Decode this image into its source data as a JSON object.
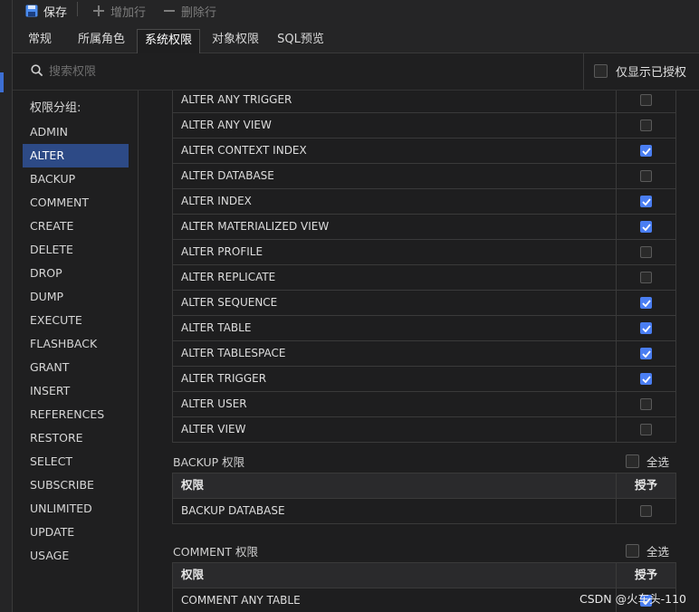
{
  "toolbar": {
    "save_label": "保存",
    "add_row_label": "增加行",
    "delete_row_label": "删除行"
  },
  "tabs": [
    {
      "label": "常规"
    },
    {
      "label": "所属角色"
    },
    {
      "label": "系统权限",
      "active": true
    },
    {
      "label": "对象权限"
    },
    {
      "label": "SQL预览"
    }
  ],
  "search": {
    "placeholder": "搜索权限",
    "value": ""
  },
  "show_granted": {
    "label": "仅显示已授权",
    "checked": false
  },
  "sidebar": {
    "group_label": "权限分组:",
    "items": [
      {
        "label": "ADMIN"
      },
      {
        "label": "ALTER",
        "active": true
      },
      {
        "label": "BACKUP"
      },
      {
        "label": "COMMENT"
      },
      {
        "label": "CREATE"
      },
      {
        "label": "DELETE"
      },
      {
        "label": "DROP"
      },
      {
        "label": "DUMP"
      },
      {
        "label": "EXECUTE"
      },
      {
        "label": "FLASHBACK"
      },
      {
        "label": "GRANT"
      },
      {
        "label": "INSERT"
      },
      {
        "label": "REFERENCES"
      },
      {
        "label": "RESTORE"
      },
      {
        "label": "SELECT"
      },
      {
        "label": "SUBSCRIBE"
      },
      {
        "label": "UNLIMITED"
      },
      {
        "label": "UPDATE"
      },
      {
        "label": "USAGE"
      }
    ]
  },
  "alter_privileges": [
    {
      "name": "ALTER ANY TRIGGER",
      "granted": false
    },
    {
      "name": "ALTER ANY VIEW",
      "granted": false
    },
    {
      "name": "ALTER CONTEXT INDEX",
      "granted": true
    },
    {
      "name": "ALTER DATABASE",
      "granted": false
    },
    {
      "name": "ALTER INDEX",
      "granted": true
    },
    {
      "name": "ALTER MATERIALIZED VIEW",
      "granted": true
    },
    {
      "name": "ALTER PROFILE",
      "granted": false
    },
    {
      "name": "ALTER REPLICATE",
      "granted": false
    },
    {
      "name": "ALTER SEQUENCE",
      "granted": true
    },
    {
      "name": "ALTER TABLE",
      "granted": true
    },
    {
      "name": "ALTER TABLESPACE",
      "granted": true
    },
    {
      "name": "ALTER TRIGGER",
      "granted": true
    },
    {
      "name": "ALTER USER",
      "granted": false
    },
    {
      "name": "ALTER VIEW",
      "granted": false
    }
  ],
  "backup_section": {
    "title": "BACKUP 权限",
    "select_all_label": "全选",
    "col_privilege": "权限",
    "col_grant": "授予",
    "rows": [
      {
        "name": "BACKUP DATABASE",
        "granted": false
      }
    ]
  },
  "comment_section": {
    "title": "COMMENT 权限",
    "select_all_label": "全选",
    "col_privilege": "权限",
    "col_grant": "授予",
    "rows": [
      {
        "name": "COMMENT ANY TABLE",
        "granted": true
      }
    ]
  },
  "watermark": "CSDN @火车头-110",
  "colors": {
    "accent": "#4a7ef2",
    "selected_bg": "#2d4a86",
    "background": "#1e1e1f"
  }
}
